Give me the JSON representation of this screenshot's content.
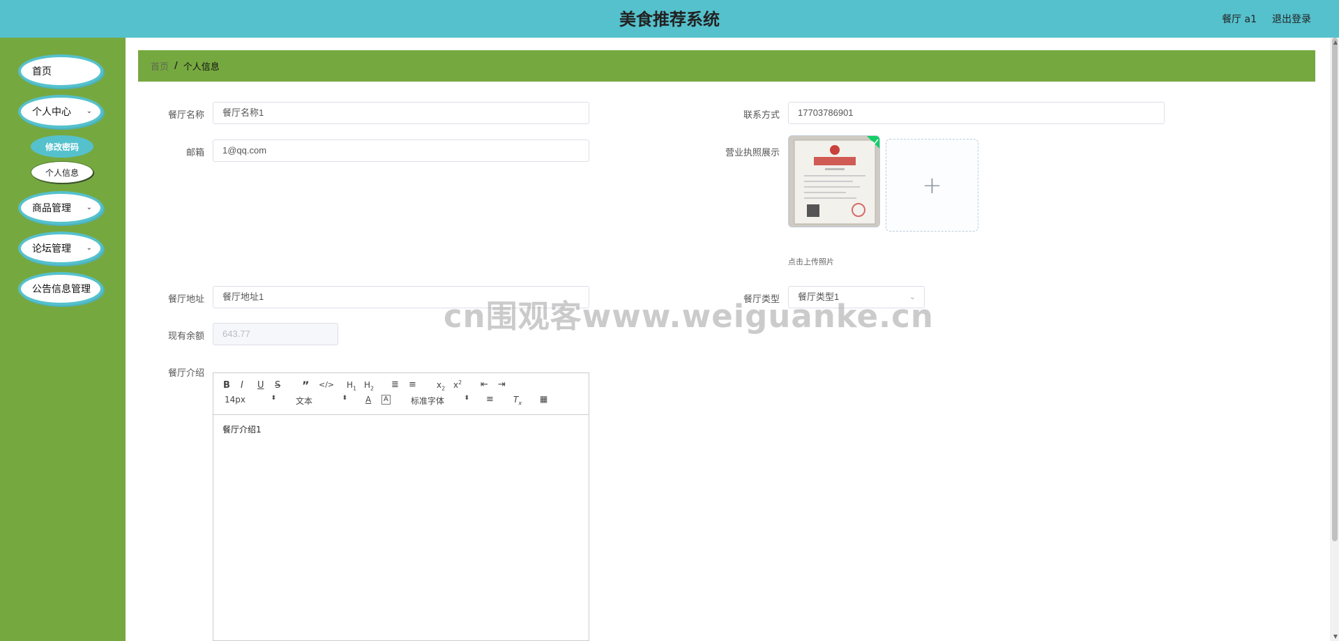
{
  "header": {
    "title": "美食推荐系统",
    "user": "餐厅 a1",
    "logout": "退出登录"
  },
  "sidebar": {
    "items": [
      {
        "label": "首页"
      },
      {
        "label": "个人中心",
        "sub": [
          {
            "label": "修改密码",
            "active": true
          },
          {
            "label": "个人信息"
          }
        ]
      },
      {
        "label": "商品管理"
      },
      {
        "label": "论坛管理"
      },
      {
        "label": "公告信息管理"
      }
    ]
  },
  "breadcrumb": {
    "home": "首页",
    "separator": "/",
    "current": "个人信息"
  },
  "form": {
    "name_label": "餐厅名称",
    "name_value": "餐厅名称1",
    "phone_label": "联系方式",
    "phone_value": "17703786901",
    "email_label": "邮箱",
    "email_value": "1@qq.com",
    "license_label": "营业执照展示",
    "upload_hint": "点击上传照片",
    "address_label": "餐厅地址",
    "address_value": "餐厅地址1",
    "type_label": "餐厅类型",
    "type_value": "餐厅类型1",
    "balance_label": "现有余额",
    "balance_value": "643.77",
    "intro_label": "餐厅介绍",
    "intro_value": "餐厅介绍1"
  },
  "editor": {
    "font_size": "14px",
    "text_style": "文本",
    "font_family": "标准字体"
  },
  "watermark": "cn围观客www.weiguanke.cn",
  "colors": {
    "header": "#55c1cd",
    "sidebar": "#76a840",
    "pill_border": "#55c1cd"
  }
}
